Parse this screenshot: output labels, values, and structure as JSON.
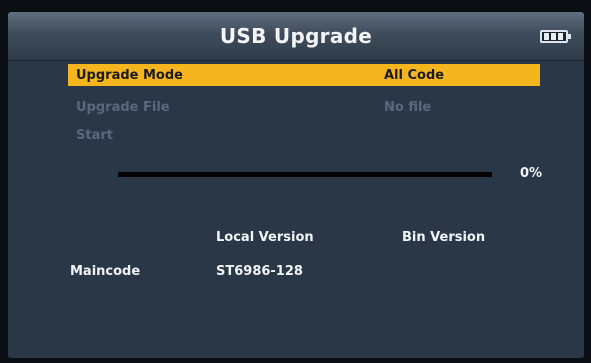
{
  "header": {
    "title": "USB Upgrade",
    "battery_icon": "battery-icon"
  },
  "menu": [
    {
      "label": "Upgrade Mode",
      "value": "All Code",
      "selected": true
    },
    {
      "label": "Upgrade File",
      "value": "No file",
      "selected": false
    },
    {
      "label": "Start",
      "value": "",
      "selected": false
    }
  ],
  "progress": {
    "percent": 0,
    "label": "0%"
  },
  "versions": {
    "headers": {
      "local": "Local Version",
      "bin": "Bin Version"
    },
    "rows": [
      {
        "name": "Maincode",
        "local": "ST6986-128",
        "bin": ""
      }
    ]
  },
  "colors": {
    "accent": "#f5b51f",
    "background": "#2a3747",
    "dim_text": "#5b6879"
  }
}
